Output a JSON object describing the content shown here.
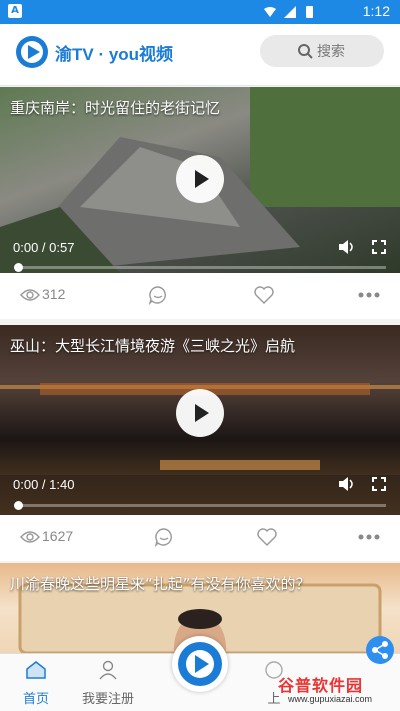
{
  "status_bar": {
    "time": "1:12",
    "app_badge": "A"
  },
  "header": {
    "brand": "渝TV · you视频",
    "search_placeholder": "搜索"
  },
  "feed": [
    {
      "title": "重庆南岸：时光留住的老街记忆",
      "time": "0:00 / 0:57",
      "views": "312"
    },
    {
      "title": "巫山：大型长江情境夜游《三峡之光》启航",
      "time": "0:00 / 1:40",
      "views": "1627"
    },
    {
      "title": "川渝春晚这些明星来“扎起”有没有你喜欢的？"
    }
  ],
  "bottom_nav": [
    {
      "label": "首页",
      "icon": "home-icon",
      "active": true
    },
    {
      "label": "我要注册",
      "icon": "user-icon",
      "active": false
    },
    {
      "label": "上",
      "icon": "upload-icon",
      "active": false
    }
  ],
  "watermark": {
    "title": "谷普软件园",
    "url": "www.gupuxiazai.com"
  },
  "colors": {
    "accent": "#1b7cd6",
    "status_bar": "#1e88e5"
  }
}
